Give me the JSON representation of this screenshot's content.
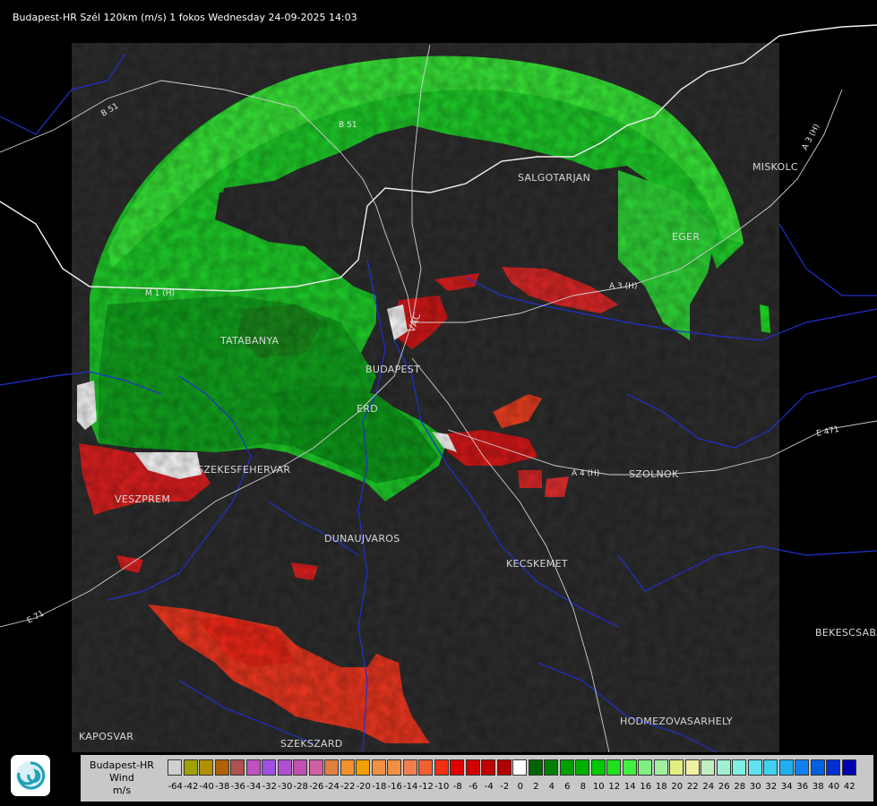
{
  "title": "Budapest-HR Szél 120km (m/s) 1 fokos Wednesday 24-09-2025 14:03",
  "cities": [
    "SALGOTARJAN",
    "MISKOLC",
    "EGER",
    "TATABANYA",
    "BUDAPEST",
    "ERD",
    "SZEKESFEHERVAR",
    "VESZPREM",
    "DUNAUJVAROS",
    "KECSKEMET",
    "SZOLNOK",
    "BEKESCSABA",
    "KAPOSVAR",
    "SZEKSZARD",
    "HODMEZOVASARHELY",
    "VAC"
  ],
  "roads": [
    "B 51",
    "B 51",
    "A 3 (H)",
    "A 3 (H)",
    "M 1 (H)",
    "E 71",
    "A 4 (H)",
    "E 471"
  ],
  "legend": {
    "station": "Budapest-HR",
    "quantity": "Wind",
    "unit": "m/s",
    "ticks": [
      "-64",
      "-42",
      "-40",
      "-38",
      "-36",
      "-34",
      "-32",
      "-30",
      "-28",
      "-26",
      "-24",
      "-22",
      "-20",
      "-18",
      "-16",
      "-14",
      "-12",
      "-10",
      "-8",
      "-6",
      "-4",
      "-2",
      "0",
      "2",
      "4",
      "6",
      "8",
      "10",
      "12",
      "14",
      "16",
      "18",
      "20",
      "22",
      "24",
      "26",
      "28",
      "30",
      "32",
      "34",
      "36",
      "38",
      "40",
      "42"
    ],
    "colors": [
      "#d0d0d0",
      "#a0a000",
      "#b09000",
      "#b06000",
      "#b05050",
      "#c050c0",
      "#a050e0",
      "#b050d0",
      "#c050b0",
      "#d060a0",
      "#e08040",
      "#f09030",
      "#f0a000",
      "#f09040",
      "#f09040",
      "#f08050",
      "#f06030",
      "#f03010",
      "#e00000",
      "#d00000",
      "#c00000",
      "#b00000",
      "#ffffff",
      "#006400",
      "#008000",
      "#00a000",
      "#00b000",
      "#00c800",
      "#20e020",
      "#40f040",
      "#80f080",
      "#a0f0a0",
      "#e0f080",
      "#f0f0a0",
      "#c0f0c0",
      "#a0f0d0",
      "#80f0e0",
      "#60e0f0",
      "#40d0f0",
      "#20b0f0",
      "#1080f0",
      "#0060e0",
      "#0030d0",
      "#0000b0"
    ]
  }
}
